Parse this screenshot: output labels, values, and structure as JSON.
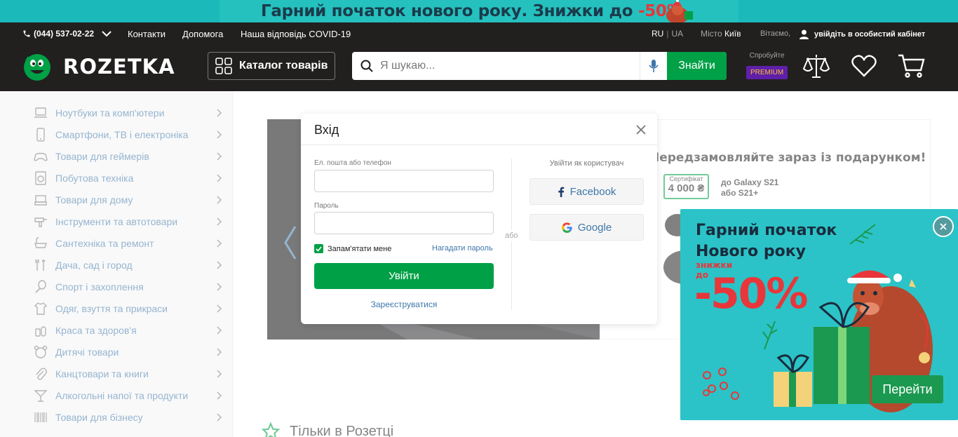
{
  "promo_banner": {
    "text": "Гарний початок нового року. Знижки до ",
    "discount": "-50%"
  },
  "topbar": {
    "phone": "(044) 537-02-22",
    "links": [
      "Контакти",
      "Допомога",
      "Наша відповідь COVID-19"
    ],
    "lang_active": "RU",
    "lang_sep": "|",
    "lang_other": "UA",
    "city_label": "Місто",
    "city": "Київ",
    "greeting": "Вітаємо,",
    "login_link": "увійдіть в особистий кабінет"
  },
  "header": {
    "logo_text": "ROZETKA",
    "catalog_label": "Каталог товарів",
    "search_placeholder": "Я шукаю...",
    "search_button": "Знайти",
    "premium_try": "Спробуйте",
    "premium_badge": "PREMIUM",
    "icons": [
      "compare-icon",
      "heart-icon",
      "cart-icon"
    ]
  },
  "sidebar": {
    "items": [
      {
        "label": "Ноутбуки та комп'ютери",
        "icon": "laptop-icon"
      },
      {
        "label": "Смартфони, ТВ і електроніка",
        "icon": "smartphone-icon"
      },
      {
        "label": "Товари для геймерів",
        "icon": "gamepad-icon"
      },
      {
        "label": "Побутова техніка",
        "icon": "washer-icon"
      },
      {
        "label": "Товари для дому",
        "icon": "sofa-icon"
      },
      {
        "label": "Інструменти та автотовари",
        "icon": "drill-icon"
      },
      {
        "label": "Сантехніка та ремонт",
        "icon": "bathtub-icon"
      },
      {
        "label": "Дача, сад і город",
        "icon": "garden-tools-icon"
      },
      {
        "label": "Спорт і захоплення",
        "icon": "racket-icon"
      },
      {
        "label": "Одяг, взуття та прикраси",
        "icon": "shirt-icon"
      },
      {
        "label": "Краса та здоров'я",
        "icon": "bottles-icon"
      },
      {
        "label": "Дитячі товари",
        "icon": "teddy-bear-icon"
      },
      {
        "label": "Канцтовари та книги",
        "icon": "paperclip-icon"
      },
      {
        "label": "Алкогольні напої та продукти",
        "icon": "cocktail-icon"
      },
      {
        "label": "Товари для бізнесу",
        "icon": "barcode-icon"
      }
    ]
  },
  "main": {
    "banner_title": "Передзамовляйте зараз із подарунком!",
    "cert_label": "Сертифікат",
    "cert_value": "4 000 ₴",
    "cert_model": "до Galaxy S21 або S21+",
    "section_title": "Тільки в Розетці"
  },
  "modal": {
    "title": "Вхід",
    "email_label": "Ел. пошта або телефон",
    "email_value": "",
    "password_label": "Пароль",
    "password_value": "",
    "remember_label": "Запам'ятати мене",
    "remember_checked": true,
    "forgot_link": "Нагадати пароль",
    "login_button": "Увійти",
    "register_link": "Зареєструватися",
    "or_label": "або",
    "as_user_label": "Увійти як користувач",
    "facebook_label": "Facebook",
    "google_label": "Google"
  },
  "popup": {
    "title_line1": "Гарний початок",
    "title_line2": "Нового року",
    "discount_line1": "знижки",
    "discount_line2": "до",
    "percent": "-50%",
    "go_button": "Перейти"
  },
  "colors": {
    "brand_green": "#00a046",
    "header_dark": "#221f1f",
    "link_blue": "#3e77aa",
    "promo_teal": "#2bc3c7",
    "discount_red": "#e8363a",
    "premium_purple": "#5f1fa9"
  }
}
